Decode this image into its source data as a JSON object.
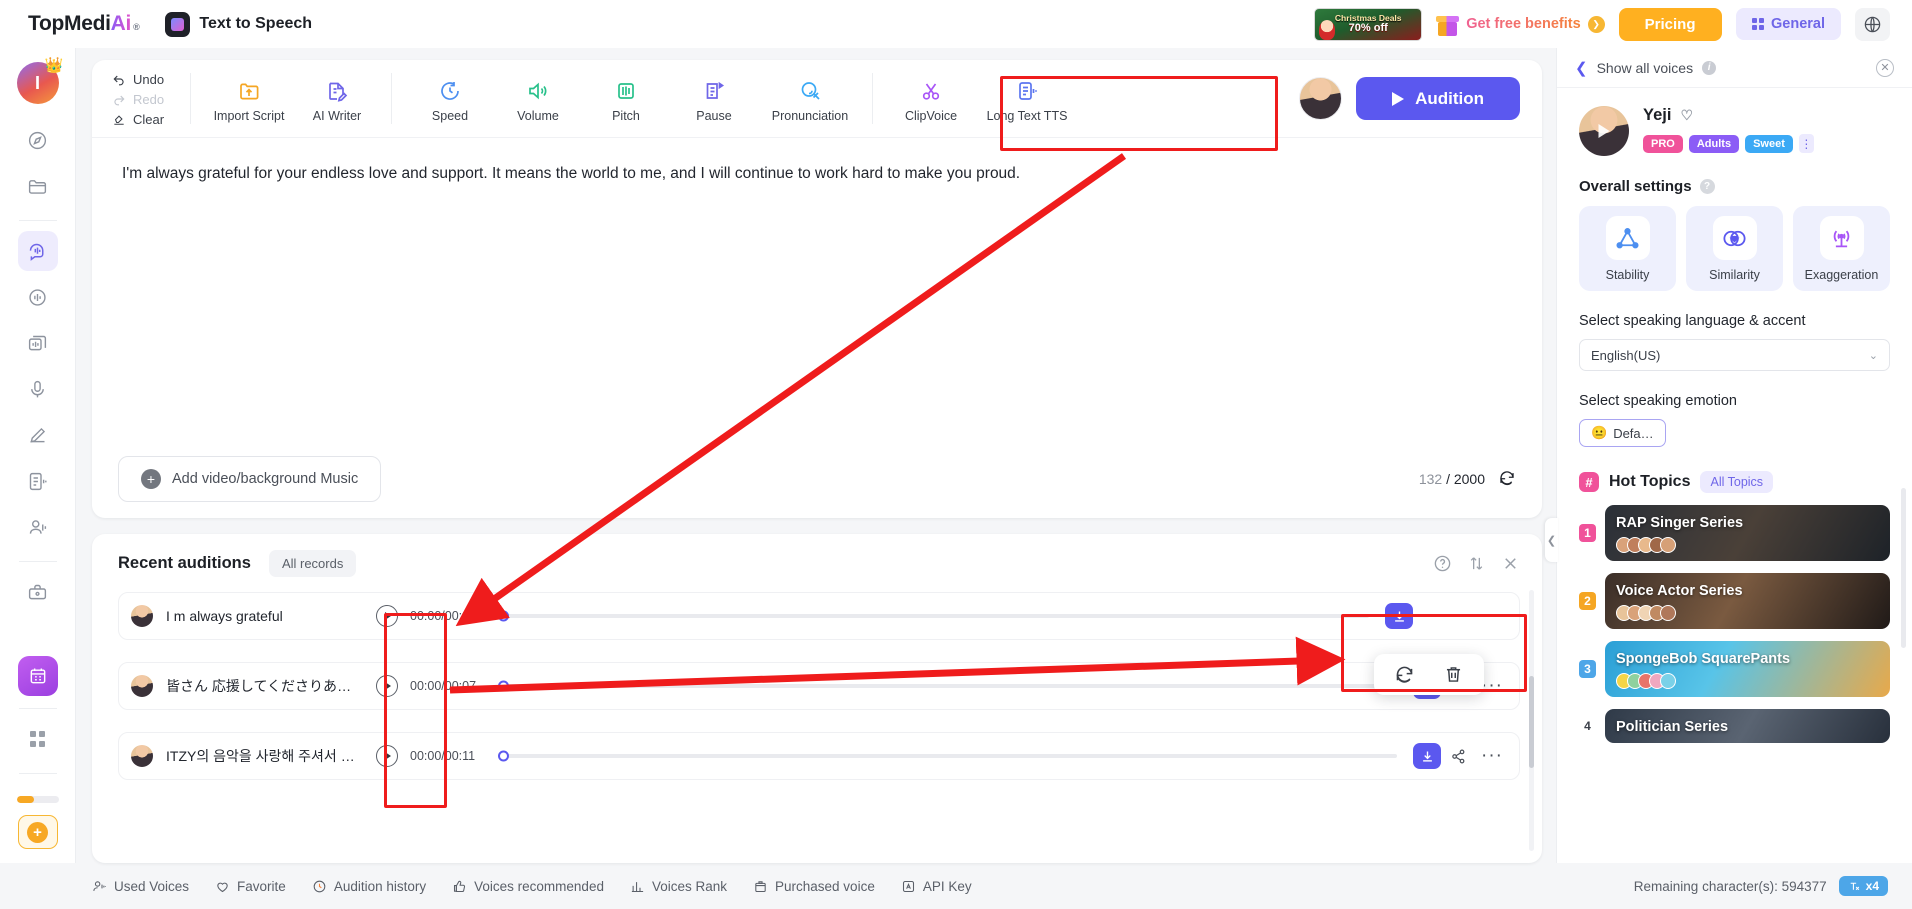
{
  "header": {
    "brand_top": "TopMedi",
    "brand_ai": "Ai",
    "brand_reg": "®",
    "product_name": "Text to Speech",
    "promo": {
      "line1": "Christmas Deals",
      "line2": "70% off"
    },
    "benefits_label": "Get free benefits",
    "benefits_arrow": "❯",
    "pricing_label": "Pricing",
    "general_label": "General",
    "globe_icon": "globe-icon"
  },
  "sidebar": {
    "avatar_initial": "I",
    "crown_icon": "crown-icon",
    "items": [
      {
        "name": "explore",
        "icon": "compass-icon"
      },
      {
        "name": "folder",
        "icon": "folder-icon"
      },
      {
        "name": "text-to-speech",
        "icon": "speech-bubble-icon",
        "active": true
      },
      {
        "name": "voice-changer",
        "icon": "waveform-circle-icon"
      },
      {
        "name": "voice-cloning",
        "icon": "stacked-cards-icon"
      },
      {
        "name": "recorder",
        "icon": "microphone-icon"
      },
      {
        "name": "ai-writer",
        "icon": "pen-mic-icon"
      },
      {
        "name": "long-text-tts",
        "icon": "document-audio-icon"
      },
      {
        "name": "video-dubbing",
        "icon": "person-speaking-icon"
      },
      {
        "name": "toolbox",
        "icon": "briefcase-icon"
      }
    ],
    "promo_icon": "calendar-gift-icon",
    "apps_icon": "grid-apps-icon",
    "plus_icon": "plus-icon"
  },
  "toolbar": {
    "undo": "Undo",
    "redo": "Redo",
    "clear": "Clear",
    "tools_left": [
      {
        "label": "Import Script",
        "icon": "import-folder-icon",
        "color": "#f5a623"
      },
      {
        "label": "AI Writer",
        "icon": "document-pen-icon",
        "color": "#6f66e8"
      }
    ],
    "tools_mid": [
      {
        "label": "Speed",
        "icon": "speed-clock-icon",
        "color": "#4d8ff0"
      },
      {
        "label": "Volume",
        "icon": "volume-speaker-icon",
        "color": "#27c08a"
      },
      {
        "label": "Pitch",
        "icon": "pitch-sliders-icon",
        "color": "#27c08a"
      },
      {
        "label": "Pause",
        "icon": "pause-document-icon",
        "color": "#6f66e8"
      },
      {
        "label": "Pronunciation",
        "icon": "pronunciation-head-icon",
        "color": "#3ba9f5"
      }
    ],
    "tools_right": [
      {
        "label": "ClipVoice",
        "icon": "scissors-icon",
        "color": "#a855f7"
      },
      {
        "label": "Long Text TTS",
        "icon": "document-audio-icon",
        "color": "#5b76f0"
      }
    ],
    "audition_label": "Audition",
    "voice_thumb": "voice-avatar"
  },
  "editor": {
    "text": "I'm always grateful for your endless love and support. It means the world to me, and I will continue to work hard to make you proud.",
    "add_media_label": "Add video/background Music",
    "char_count": "132",
    "char_sep": "/",
    "char_max": "2000",
    "refresh_icon": "refresh-icon"
  },
  "auditions": {
    "title": "Recent auditions",
    "all_records": "All records",
    "help_icon": "help-circle-icon",
    "sort_icon": "sort-updown-icon",
    "close_icon": "close-icon",
    "rows": [
      {
        "name": "I m always grateful",
        "time": "00:00/00:09",
        "has_share": false,
        "has_more": false
      },
      {
        "name": "皆さん 応援してくださりあり…",
        "time": "00:00/00:07",
        "has_share": true,
        "has_more": true
      },
      {
        "name": "ITZY의 음악을 사랑해 주셔서 …",
        "time": "00:00/00:11",
        "has_share": true,
        "has_more": true
      }
    ],
    "popup_menu": [
      {
        "name": "regenerate",
        "icon": "refresh-icon"
      },
      {
        "name": "delete",
        "icon": "trash-icon"
      }
    ]
  },
  "voice_panel": {
    "show_all_label": "Show all voices",
    "info_icon": "info-icon",
    "close_icon": "close-icon",
    "voice_name": "Yeji",
    "heart_icon": "heart-icon",
    "badges": [
      {
        "text": "PRO",
        "color": "#f0529a"
      },
      {
        "text": "Adults",
        "color": "#8b5cf6"
      },
      {
        "text": "Sweet",
        "color": "#3ba9f5"
      }
    ],
    "more_dots": "⋮",
    "overall_settings_label": "Overall settings",
    "settings": [
      {
        "label": "Stability",
        "icon": "triangle-nodes-icon",
        "color": "#4d8ff0"
      },
      {
        "label": "Similarity",
        "icon": "venn-circles-icon",
        "color": "#5b58ef"
      },
      {
        "label": "Exaggeration",
        "icon": "broadcast-icon",
        "color": "#a855f7"
      }
    ],
    "language_label": "Select speaking language & accent",
    "language_value": "English(US)",
    "chevron": "⌄",
    "emotion_label": "Select speaking emotion",
    "emotion_value": "Defa…",
    "emotion_emoji": "😐"
  },
  "hot_topics": {
    "title": "Hot Topics",
    "hash": "#",
    "all_topics": "All Topics",
    "items": [
      {
        "rank": "1",
        "rank_color": "#f0529a",
        "name": "RAP Singer Series",
        "bg": "linear-gradient(120deg,#2a3038 0%,#4a4038 50%,#1d2228 100%)"
      },
      {
        "rank": "2",
        "rank_color": "#f5a623",
        "name": "Voice Actor Series",
        "bg": "linear-gradient(120deg,#3a2e28 0%,#7a5a40 45%,#201a18 100%)"
      },
      {
        "rank": "3",
        "rank_color": "#4da6e8",
        "name": "SpongeBob SquarePants",
        "bg": "linear-gradient(120deg,#2a9fd6 0%,#58c4e8 40%,#e8a94a 100%)"
      },
      {
        "rank": "4",
        "rank_color": "transparent",
        "name": "Politician Series",
        "bg": "linear-gradient(120deg,#2f3a48 0%,#5a6472 50%,#28303c 100%)"
      }
    ]
  },
  "bottombar": {
    "items": [
      {
        "label": "Used Voices",
        "icon": "person-voice-icon"
      },
      {
        "label": "Favorite",
        "icon": "heart-icon"
      },
      {
        "label": "Audition history",
        "icon": "clock-icon"
      },
      {
        "label": "Voices recommended",
        "icon": "thumbup-icon"
      },
      {
        "label": "Voices Rank",
        "icon": "bar-chart-icon"
      },
      {
        "label": "Purchased voice",
        "icon": "box-icon"
      },
      {
        "label": "API Key",
        "icon": "api-icon"
      }
    ],
    "remaining_label": "Remaining character(s): 594377",
    "multiplier": "x4"
  }
}
